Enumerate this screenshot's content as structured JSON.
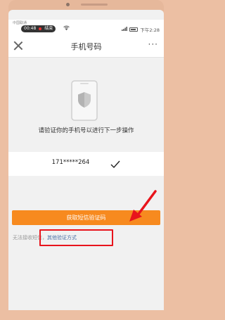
{
  "statusbar": {
    "carrier": "中国联通",
    "recording_time": "00:48",
    "recording_label": "结束",
    "clock": "下午2:28"
  },
  "navbar": {
    "title": "手机号码",
    "close_icon": "close-icon",
    "more_icon": "more-icon",
    "more_label": "···"
  },
  "main": {
    "illustration_icon": "phone-shield-icon",
    "prompt": "请验证你的手机号以进行下一步操作",
    "phone_number": "171*****264",
    "check_icon": "checkmark-icon",
    "get_code_label": "获取短信验证码",
    "alt_prefix": "无法接收短信，",
    "alt_link": "其他验证方式"
  },
  "colors": {
    "accent_orange": "#f78a1f",
    "annotation_red": "#e8141c",
    "link_blue": "#4a6fa5"
  }
}
